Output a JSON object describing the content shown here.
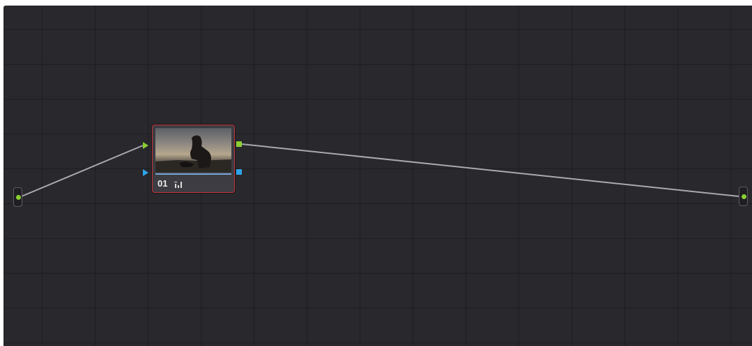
{
  "colors": {
    "canvas_bg": "#28282d",
    "rgb_port": "#8bd033",
    "key_port": "#2ea4e8",
    "node_selected_border": "#c8343a",
    "connection_line": "#a9a9b0"
  },
  "node": {
    "label": "01",
    "tool_icon": "histogram-icon",
    "selected": true
  }
}
